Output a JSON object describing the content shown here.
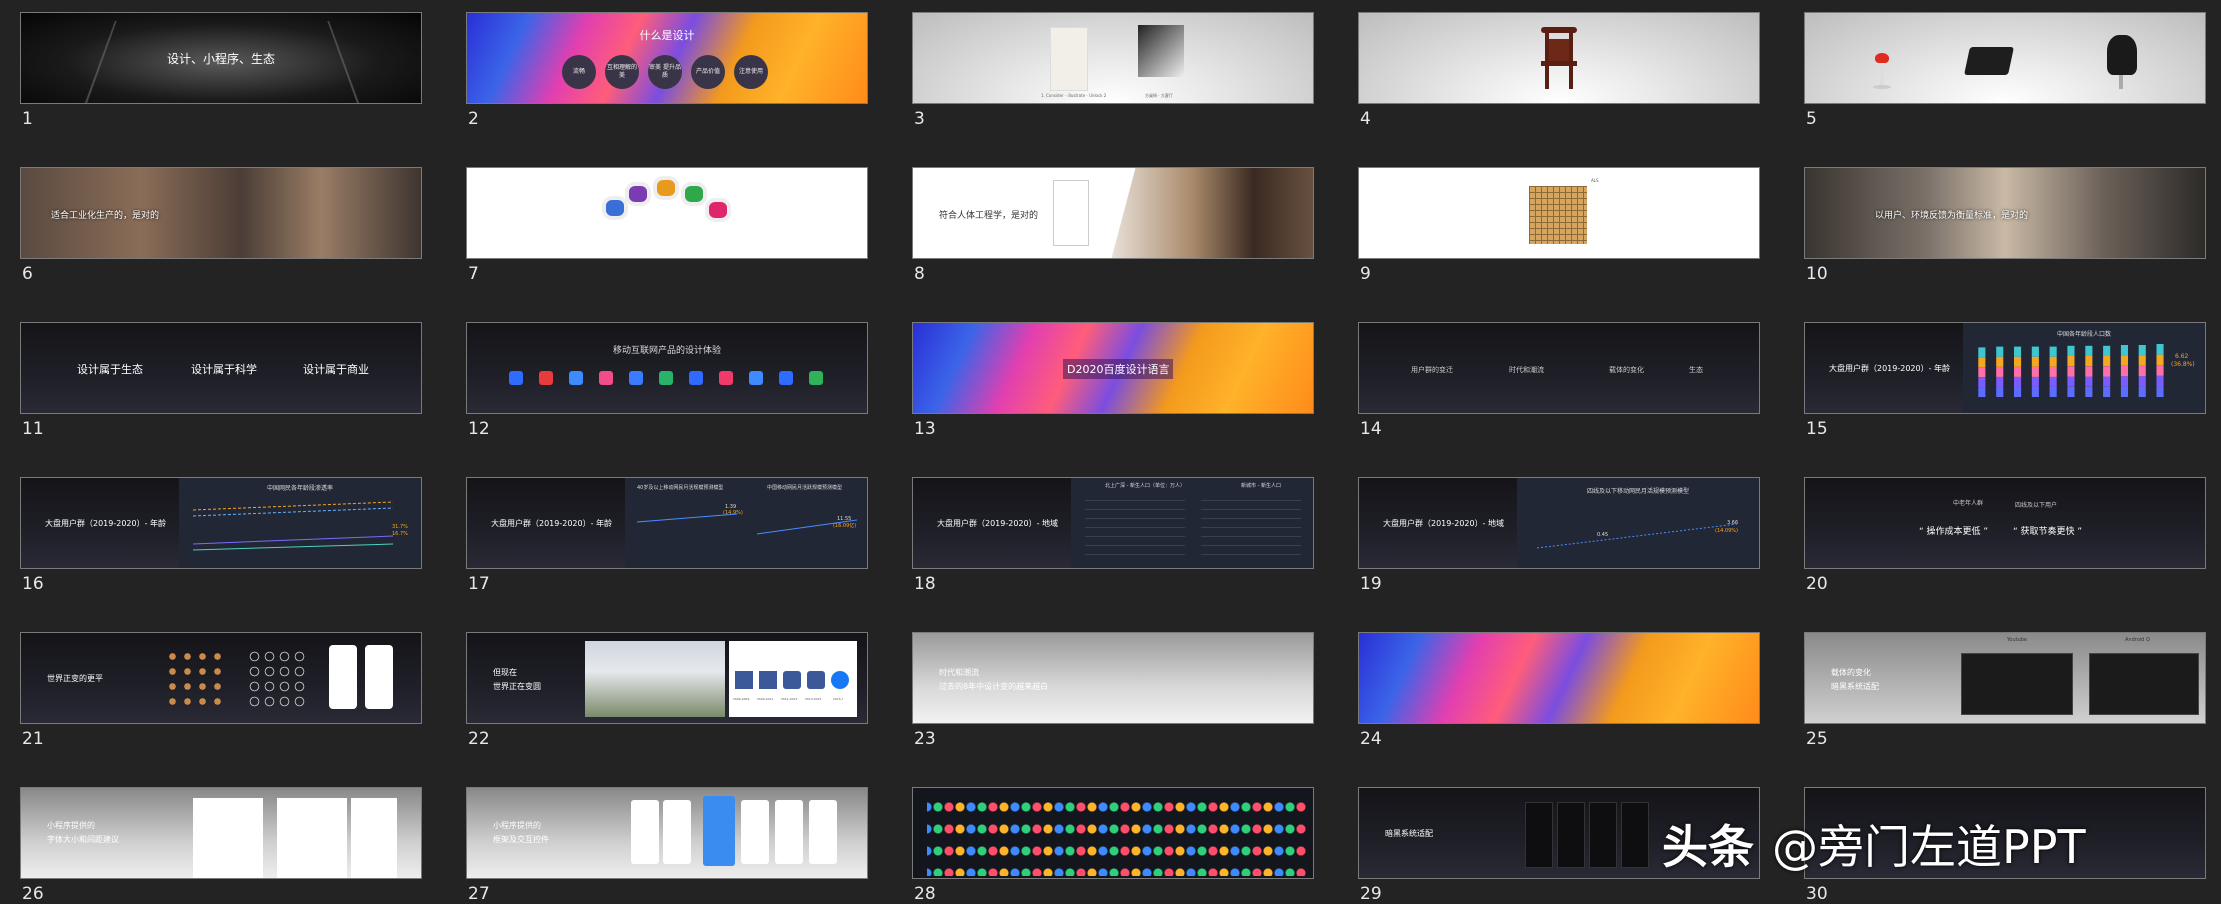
{
  "slides": [
    {
      "n": "1",
      "title": "设计、小程序、生态"
    },
    {
      "n": "2",
      "title": "什么是设计",
      "bubbles": [
        "流畅",
        "互相理解的美",
        "审美 提升品质",
        "产品价值",
        "注意使用"
      ]
    },
    {
      "n": "3",
      "caption_left": "1. Consider · illustrate · Unlock 2",
      "caption_right": "方桌椅 · 大客厅"
    },
    {
      "n": "4"
    },
    {
      "n": "5"
    },
    {
      "n": "6",
      "title": "适合工业化生产的，是对的"
    },
    {
      "n": "7"
    },
    {
      "n": "8",
      "title": "符合人体工程学，是对的"
    },
    {
      "n": "9",
      "label": "ALS"
    },
    {
      "n": "10",
      "title": "以用户、环境反馈为衡量标准，是对的"
    },
    {
      "n": "11",
      "items": [
        "设计属于生态",
        "设计属于科学",
        "设计属于商业"
      ]
    },
    {
      "n": "12",
      "title": "移动互联网产品的设计体验"
    },
    {
      "n": "13",
      "title": "D2020百度设计语言"
    },
    {
      "n": "14",
      "items": [
        "用户群的变迁",
        "时代和潮流",
        "载体的变化",
        "生态"
      ]
    },
    {
      "n": "15",
      "title": "大盘用户群（2019-2020）- 年龄",
      "chart_title": "中国各年龄段人口数",
      "value": "6.62",
      "pct": "(36.8%)"
    },
    {
      "n": "16",
      "title": "大盘用户群（2019-2020）- 年龄",
      "chart_title": "中国网民各年龄段渗透率",
      "v1": "31.7%",
      "v2": "16.7%"
    },
    {
      "n": "17",
      "title": "大盘用户群（2019-2020）- 年龄",
      "chart_left": "40岁及以上移动网民月活规模预测模型",
      "chart_right": "中国移动网民月活跃规模预测模型",
      "v1": "1.39",
      "v2": "(14.9%)",
      "v3": "11.55",
      "v4": "(16.09亿)"
    },
    {
      "n": "18",
      "title": "大盘用户群（2019-2020）- 地域",
      "chart_left": "北上广深 - 新生人口（单位：万人）",
      "chart_right": "新城市 - 新生人口"
    },
    {
      "n": "19",
      "title": "大盘用户群（2019-2020）- 地域",
      "chart_title": "四线及以下移动网民月活规模预测模型",
      "v1": "0.45",
      "v2": "3.66",
      "v3": "(14.09%)"
    },
    {
      "n": "20",
      "top1": "中老年人群",
      "top2": "四线及以下用户",
      "quote1": "“ 操作成本更低 ”",
      "quote2": "“ 获取节奏更快 ”"
    },
    {
      "n": "21",
      "title": "世界正变的更平"
    },
    {
      "n": "22",
      "line1": "但现在",
      "line2": "世界正在变圆",
      "years": [
        "2006-2009",
        "2009-2011",
        "2011-2013",
        "2013-2015",
        "2015-?"
      ]
    },
    {
      "n": "23",
      "line1": "时代和潮流",
      "line2": "过去的8年中设计变的越来越白"
    },
    {
      "n": "24"
    },
    {
      "n": "25",
      "line1": "载体的变化",
      "line2": "暗黑系统适配",
      "label_left": "Youtube",
      "label_right": "Android Q"
    },
    {
      "n": "26",
      "line1": "小程序提供的",
      "line2": "字体大小和间距建议"
    },
    {
      "n": "27",
      "line1": "小程序提供的",
      "line2": "框架及交互控件"
    },
    {
      "n": "28"
    },
    {
      "n": "29",
      "title": "暗黑系统适配"
    },
    {
      "n": "30"
    }
  ],
  "watermark": {
    "brand": "头条",
    "handle": "@旁门左道PPT"
  },
  "colors": {
    "accent": "#f5a623",
    "bg": "#232323",
    "frame": "#7a7a7a"
  },
  "chart_data": [
    {
      "type": "bar",
      "title": "中国各年龄段人口数",
      "categories": [
        "2012",
        "2013",
        "2014",
        "2015",
        "2016",
        "2017",
        "2018a",
        "2019a",
        "2020a",
        "2021a",
        "2022a"
      ],
      "series": [],
      "values": [
        6.2,
        6.3,
        6.3,
        6.3,
        6.3,
        6.4,
        6.4,
        6.4,
        6.5,
        6.5,
        6.62
      ]
    }
  ]
}
